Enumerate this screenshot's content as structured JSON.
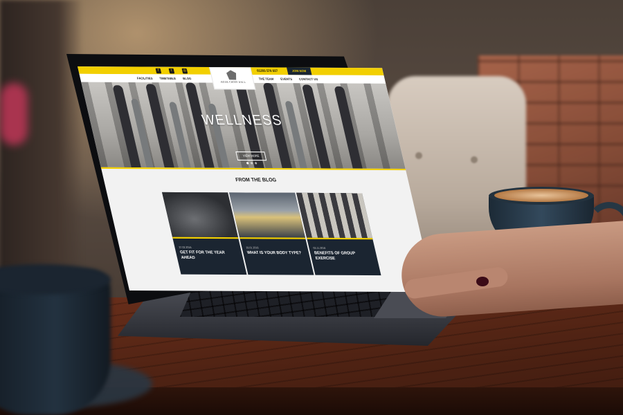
{
  "site": {
    "social_icons": [
      "facebook-icon",
      "twitter-icon",
      "instagram-icon"
    ],
    "phone": "01283 576 027",
    "join_label": "JOIN NOW",
    "logo_text": "HOAR CROSS HALL",
    "nav_left": [
      "FACILITIES",
      "TIMETABLE",
      "BLOG"
    ],
    "nav_right": [
      "THE TEAM",
      "EVENTS",
      "CONTACT US"
    ],
    "colors": {
      "accent": "#f2cf00",
      "dark": "#1b2531"
    }
  },
  "hero": {
    "title": "WELLNESS",
    "button": "VIEW MORE"
  },
  "blog": {
    "title": "FROM THE BLOG",
    "cards": [
      {
        "date": "27.02.2018",
        "headline": "GET FIT FOR THE YEAR AHEAD"
      },
      {
        "date": "28.01.2018",
        "headline": "WHAT IS YOUR BODY TYPE?"
      },
      {
        "date": "03.11.2018",
        "headline": "BENEFITS OF GROUP EXERCISE"
      }
    ]
  }
}
